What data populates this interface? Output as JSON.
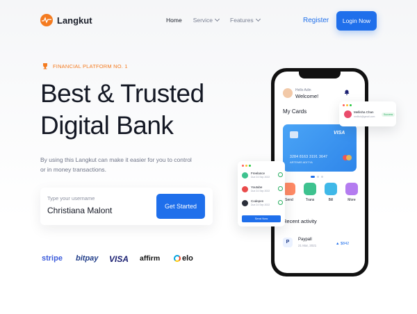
{
  "nav": {
    "brand": "Langkut",
    "menu": [
      {
        "label": "Home",
        "active": true
      },
      {
        "label": "Service",
        "active": false
      },
      {
        "label": "Features",
        "active": false
      }
    ],
    "register": "Register",
    "login": "Login Now"
  },
  "hero": {
    "badge": "FINANCIAL PLATFORM NO. 1",
    "title_line1": "Best & Trusted",
    "title_line2": "Digital Bank",
    "description": "By using this Langkut can make it easier for you to control or in money transactions.",
    "input_label": "Type your username",
    "input_value": "Christiana Malont",
    "cta": "Get Started"
  },
  "brands": [
    "stripe",
    "bitpay",
    "VISA",
    "affirm",
    "elo"
  ],
  "phone": {
    "hello": "Hello Adin",
    "welcome": "Welcome!",
    "my_cards": "My Cards",
    "card_brand": "VISA",
    "card_number": "3284 8163 3191 3647",
    "card_name": "ARTEMIS ADITYA",
    "actions": [
      "Send",
      "Trans",
      "Bill",
      "More"
    ],
    "recent_title": "Recent activity",
    "recent": {
      "name": "Paypall",
      "date": "21  Mar, 2021",
      "amount": "▲ $842"
    }
  },
  "tasks": {
    "items": [
      {
        "name": "Freelance",
        "date": "Due 24 Sep 2022"
      },
      {
        "name": "Youtube",
        "date": "Due 24 Sep 2022"
      },
      {
        "name": "Codepen",
        "date": "Due 24 Sep 2022"
      }
    ],
    "button": "Send Now"
  },
  "profile": {
    "name": "Mellisha Chan",
    "email": "mellish@gmail.com",
    "status": "Success"
  },
  "colors": {
    "accent": "#1f6feb",
    "brand_orange": "#f47b20"
  }
}
